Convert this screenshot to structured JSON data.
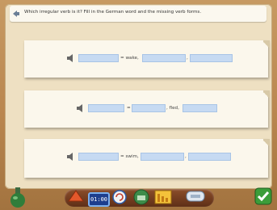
{
  "question": "Which irregular verb is it? Fill in the German word and the missing verb forms.",
  "rows": [
    {
      "text": "= wake,",
      "sep": ","
    },
    {
      "eq": "=",
      "text": ", fled,"
    },
    {
      "text": "= swim,",
      "sep": ","
    }
  ],
  "toolbar": {
    "clock": "01:00"
  },
  "colors": {
    "blank_fill": "#c6daf2",
    "paper": "#fbf7ec",
    "background": "#b9864f"
  }
}
